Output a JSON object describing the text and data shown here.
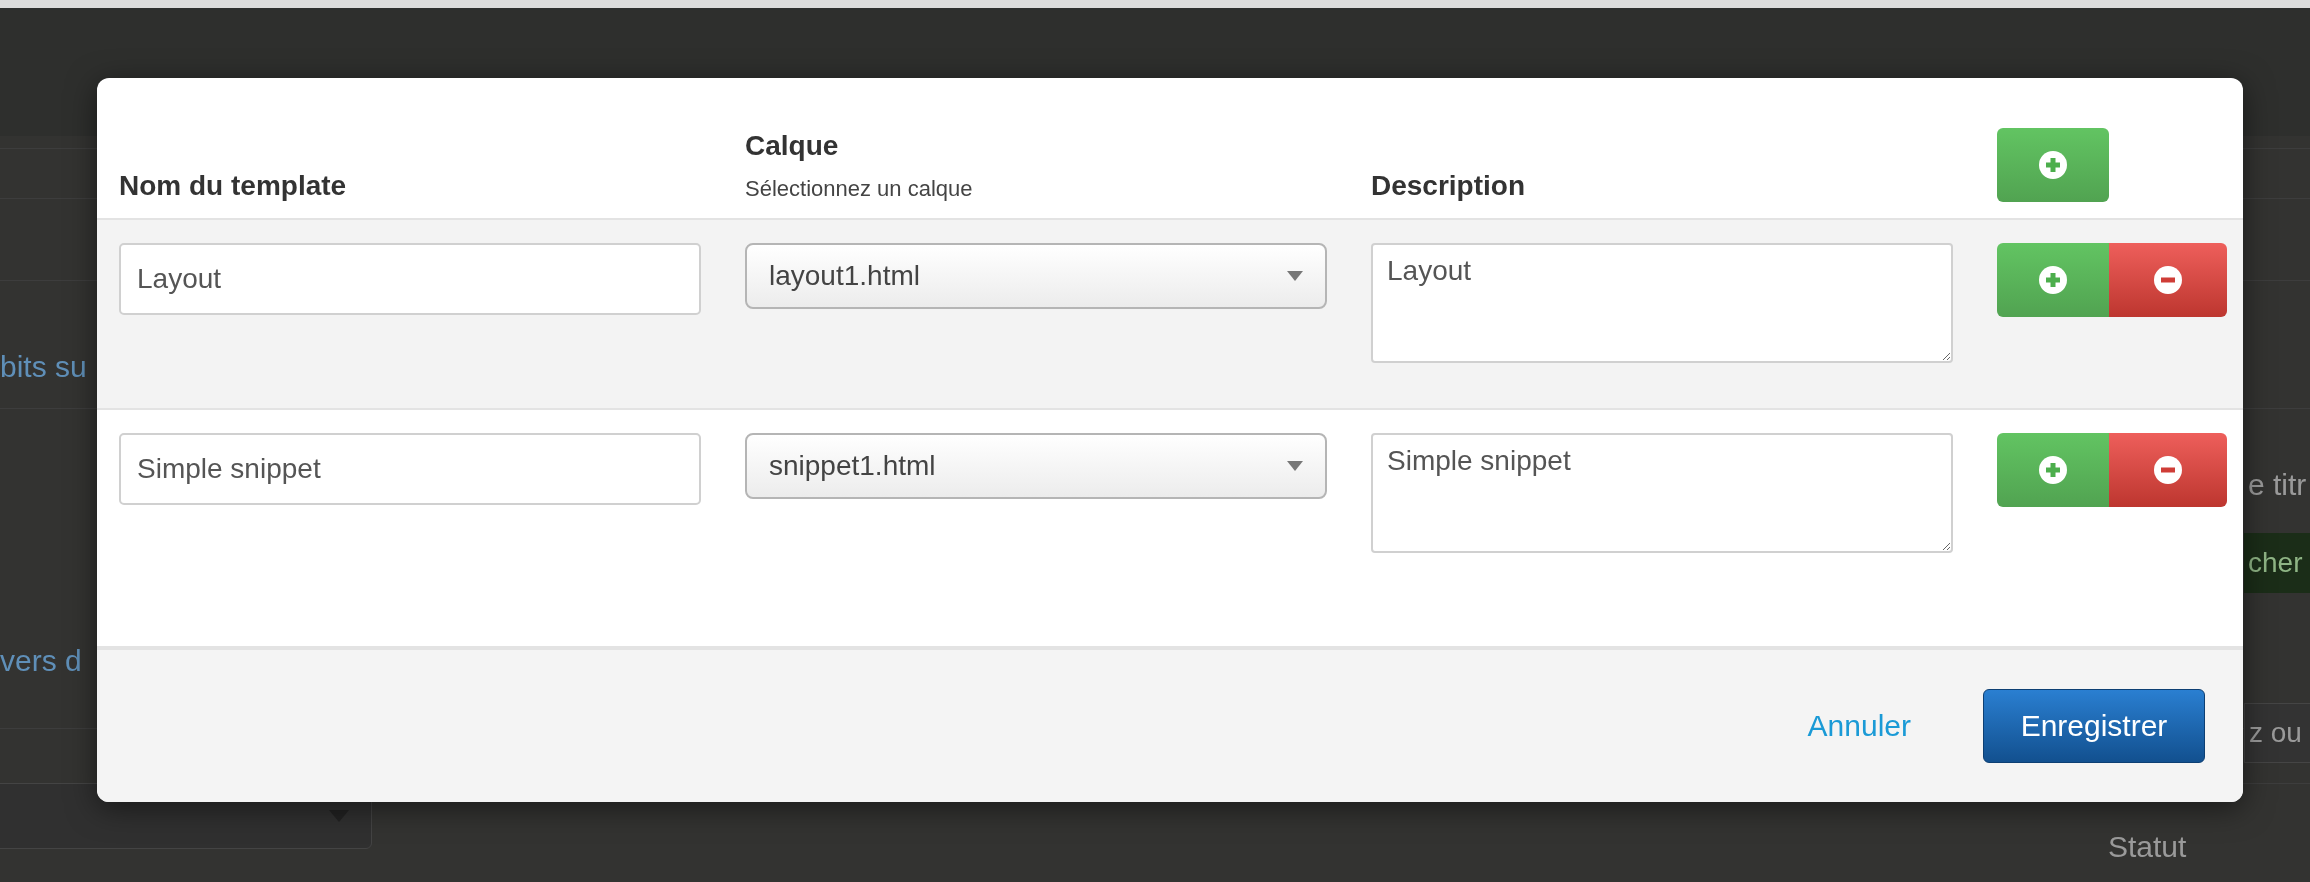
{
  "background": {
    "left_texts": [
      "bits su",
      "vers d"
    ],
    "right_text": "e titr",
    "right_button": "cher",
    "right_field": {
      "placeholder": "z ou"
    },
    "status_label": "Statut"
  },
  "modal": {
    "columns": [
      {
        "label": "Nom du template"
      },
      {
        "label": "Calque",
        "hint": "Sélectionnez un calque"
      },
      {
        "label": "Description"
      }
    ],
    "rows": [
      {
        "name": "Layout",
        "layer": "layout1.html",
        "description": "Layout",
        "highlighted": true
      },
      {
        "name": "Simple snippet",
        "layer": "snippet1.html",
        "description": "Simple snippet",
        "highlighted": false
      }
    ],
    "footer": {
      "cancel": "Annuler",
      "save": "Enregistrer"
    }
  }
}
